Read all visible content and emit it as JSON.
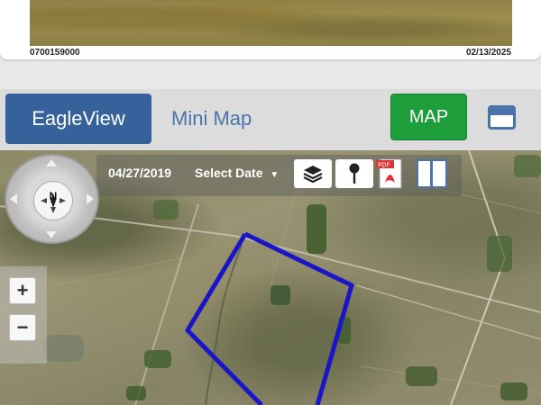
{
  "photo_card": {
    "parcel_id": "0700159000",
    "photo_date": "02/13/2025"
  },
  "tabs": {
    "eagleview_label": "EagleView",
    "minimap_label": "Mini Map",
    "map_button_label": "MAP"
  },
  "map": {
    "imagery_date": "04/27/2019",
    "select_date_label": "Select Date",
    "compass_label": "N",
    "zoom_in_label": "+",
    "zoom_out_label": "−",
    "boundary_color": "#1a16c8",
    "icons": [
      "layers-icon",
      "pin-icon",
      "pdf-icon",
      "compare-icon",
      "window-icon",
      "compass-icon"
    ]
  },
  "colors": {
    "eagleview_tab": "#35629b",
    "map_button": "#1e9e3a",
    "link_text": "#4a74aa"
  }
}
